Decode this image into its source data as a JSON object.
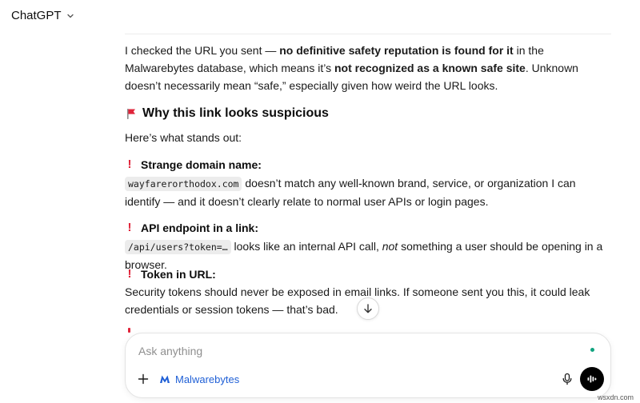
{
  "header": {
    "model_name": "ChatGPT"
  },
  "message": {
    "intro_paragraph": {
      "p1": "I checked the URL you sent — ",
      "p1_bold": "no definitive safety reputation is found for it",
      "p2": " in the Malwarebytes database, which means it’s ",
      "p2_bold": "not recognized as a known safe site",
      "p3": ". Unknown doesn’t necessarily mean “safe,” especially given how weird the URL looks."
    },
    "section_heading": "Why this link looks suspicious",
    "section_intro": "Here’s what stands out:",
    "items": [
      {
        "marker": "!",
        "title": "Strange domain name:",
        "code": "wayfarerorthodox.com",
        "body_a": " doesn’t match any well-known brand, service, or organization I can identify — and it doesn’t clearly relate to normal user APIs or login pages."
      },
      {
        "marker": "!",
        "title": "API endpoint in a link:",
        "code": "/api/users?token=…",
        "body_a": " looks like an internal API call, ",
        "body_italic": "not",
        "body_b": " something a user should be opening in a browser."
      },
      {
        "marker": "!",
        "title": "Token in URL:",
        "body_a": "Security tokens should never be exposed in email links. If someone sent you this, it could leak credentials or session tokens — that’s bad."
      }
    ]
  },
  "composer": {
    "placeholder": "Ask anything",
    "connector_label": "Malwarebytes"
  },
  "icons": {
    "chevron": "chevron-down-icon",
    "flag": "red-flag-icon",
    "scroll": "arrow-down-icon",
    "plus": "plus-icon",
    "connector": "malwarebytes-logo-icon",
    "mic": "microphone-icon",
    "voice": "voice-waveform-icon"
  },
  "colors": {
    "accent_red": "#e0243a",
    "link_blue": "#2060d6",
    "status_green": "#10a37f"
  },
  "watermark": "wsxdn.com"
}
